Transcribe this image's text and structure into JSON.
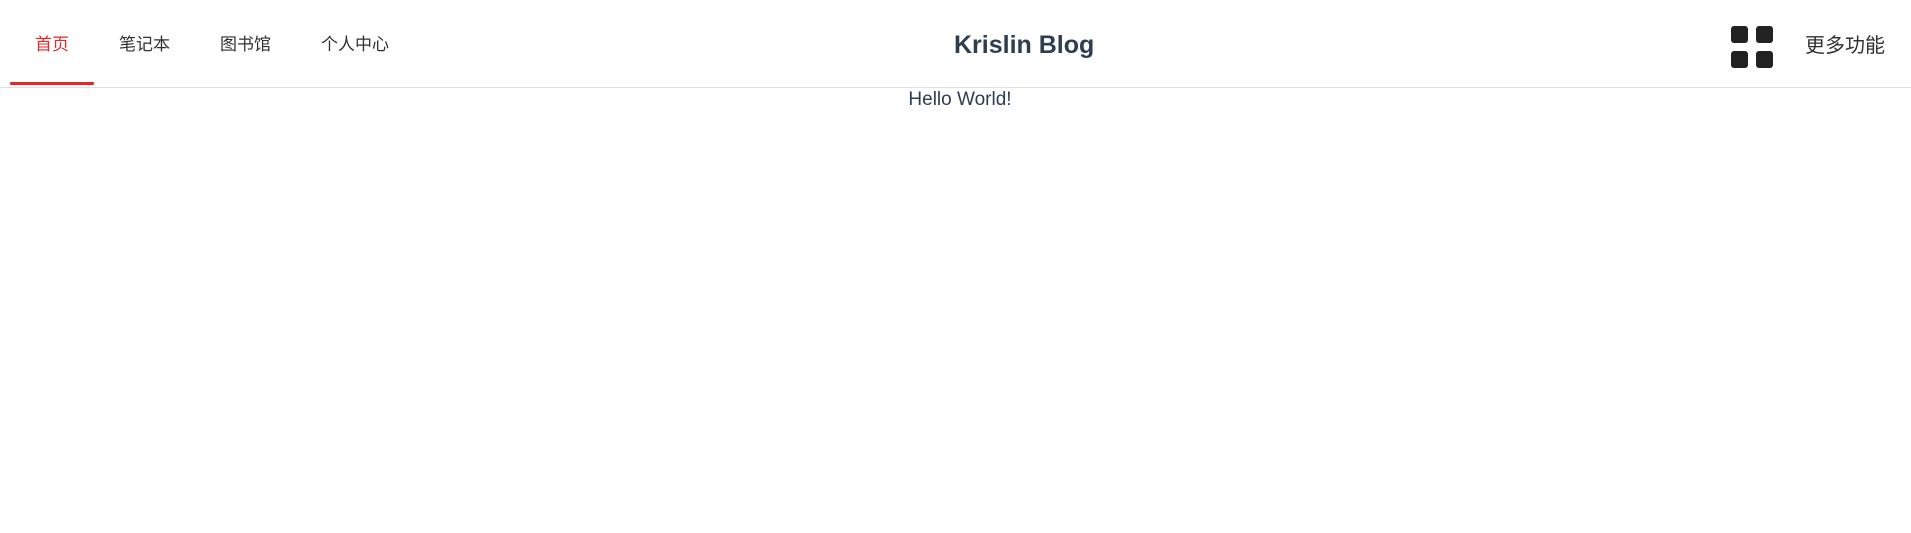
{
  "app": {
    "brand_title": "Krislin Blog"
  },
  "nav": {
    "items": [
      {
        "label": "首页",
        "active": true
      },
      {
        "label": "笔记本",
        "active": false
      },
      {
        "label": "图书馆",
        "active": false
      },
      {
        "label": "个人中心",
        "active": false
      }
    ]
  },
  "header_right": {
    "apps_icon": "grid-icon",
    "more_label": "更多功能"
  },
  "main": {
    "message": "Hello World!"
  },
  "colors": {
    "accent": "#e0292b",
    "text": "#2c3e50",
    "nav_text": "#303133",
    "icon": "#222222"
  }
}
